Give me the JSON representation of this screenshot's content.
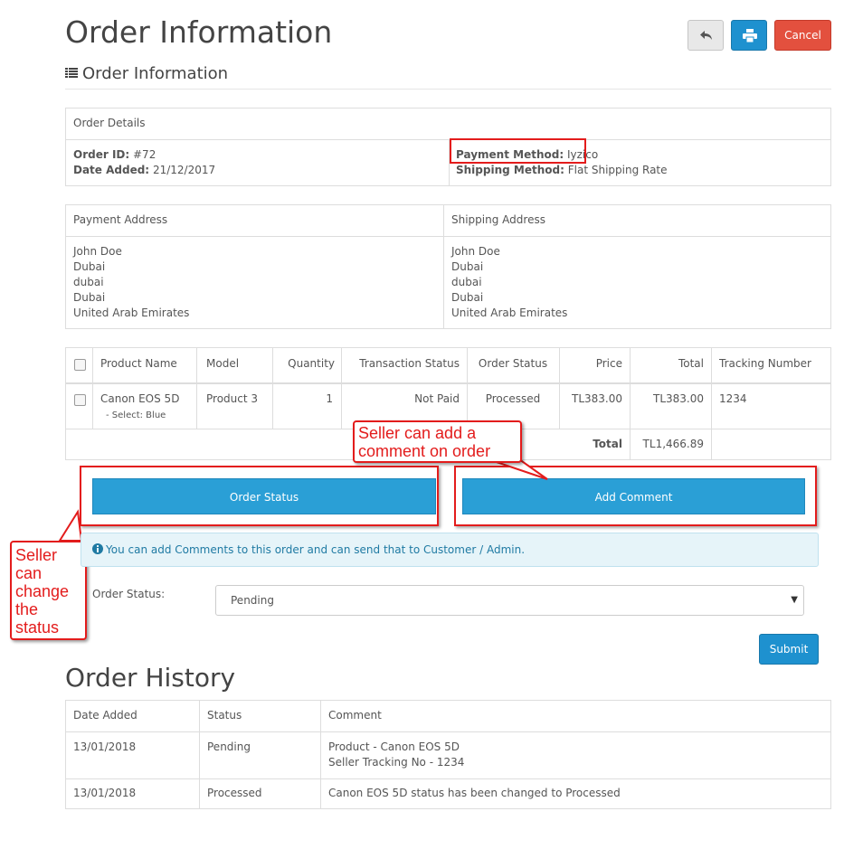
{
  "page": {
    "title": "Order Information",
    "subtitle": "Order Information",
    "cancel_label": "Cancel"
  },
  "order_details": {
    "header": "Order Details",
    "order_id_label": "Order ID:",
    "order_id": "#72",
    "date_added_label": "Date Added:",
    "date_added": "21/12/2017",
    "payment_method_label": "Payment Method:",
    "payment_method": "Iyzico",
    "shipping_method_label": "Shipping Method:",
    "shipping_method": "Flat Shipping Rate"
  },
  "addresses": {
    "payment_header": "Payment Address",
    "shipping_header": "Shipping Address",
    "payment_lines": [
      "John Doe",
      "Dubai",
      "dubai",
      "Dubai",
      "United Arab Emirates"
    ],
    "shipping_lines": [
      "John Doe",
      "Dubai",
      "dubai",
      "Dubai",
      "United Arab Emirates"
    ]
  },
  "products": {
    "columns": [
      "Product Name",
      "Model",
      "Quantity",
      "Transaction Status",
      "Order Status",
      "Price",
      "Total",
      "Tracking Number"
    ],
    "rows": [
      {
        "name": "Canon EOS 5D",
        "option": "- Select: Blue",
        "model": "Product 3",
        "quantity": "1",
        "transaction_status": "Not Paid",
        "order_status": "Processed",
        "price": "TL383.00",
        "total": "TL383.00",
        "tracking": "1234"
      }
    ],
    "total_label": "Total",
    "total_value": "TL1,466.89"
  },
  "actions": {
    "order_status_button": "Order Status",
    "add_comment_button": "Add Comment"
  },
  "annotations": {
    "comment_callout": "Seller can add a comment on order",
    "status_callout": [
      "Seller",
      "can",
      "change",
      "the",
      "status"
    ]
  },
  "alert": {
    "text": "You can add Comments to this order and can send that to Customer / Admin."
  },
  "status_form": {
    "label": "Order Status:",
    "selected": "Pending",
    "submit_label": "Submit"
  },
  "history": {
    "title": "Order History",
    "columns": [
      "Date Added",
      "Status",
      "Comment"
    ],
    "rows": [
      {
        "date": "13/01/2018",
        "status": "Pending",
        "comment_lines": [
          "Product - Canon EOS 5D",
          "Seller Tracking No - 1234"
        ]
      },
      {
        "date": "13/01/2018",
        "status": "Processed",
        "comment_lines": [
          "Canon EOS 5D status has been changed to Processed"
        ]
      }
    ]
  },
  "colors": {
    "primary": "#1e91cf",
    "action_blue": "#2a9fd6",
    "danger": "#e3503e",
    "annotation_red": "#e31c1c",
    "info_bg": "#e6f4f9"
  }
}
